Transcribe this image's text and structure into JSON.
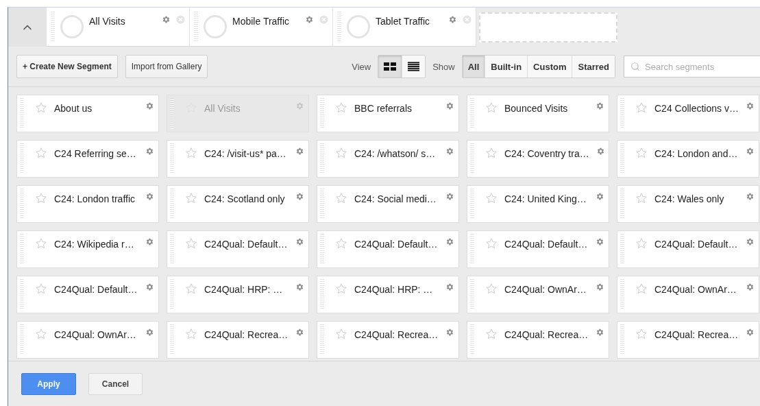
{
  "segment_bar": {
    "segments": [
      {
        "name": "All Visits"
      },
      {
        "name": "Mobile Traffic"
      },
      {
        "name": "Tablet Traffic"
      }
    ],
    "empty_slot": true
  },
  "toolbar": {
    "create_button": "+ Create New Segment",
    "import_button": "Import from Gallery",
    "view_label": "View",
    "view_modes": [
      {
        "kind": "grid",
        "selected": true
      },
      {
        "kind": "list",
        "selected": false
      }
    ],
    "show_label": "Show",
    "filters": [
      {
        "label": "All",
        "selected": true
      },
      {
        "label": "Built-in",
        "selected": false
      },
      {
        "label": "Custom",
        "selected": false
      },
      {
        "label": "Starred",
        "selected": false
      }
    ],
    "search": {
      "placeholder": "Search segments"
    }
  },
  "cards": [
    {
      "name": "About us",
      "starred": false,
      "disabled": false
    },
    {
      "name": "All Visits",
      "starred": false,
      "disabled": true
    },
    {
      "name": "BBC referrals",
      "starred": false,
      "disabled": false
    },
    {
      "name": "Bounced Visits",
      "starred": false,
      "disabled": false
    },
    {
      "name": "C24 Collections v…",
      "starred": false,
      "disabled": false
    },
    {
      "name": "C24 Referring se…",
      "starred": false,
      "disabled": false
    },
    {
      "name": "C24: /visit-us* pa…",
      "starred": false,
      "disabled": false
    },
    {
      "name": "C24: /whatson/ s…",
      "starred": false,
      "disabled": false
    },
    {
      "name": "C24: Coventry tra…",
      "starred": false,
      "disabled": false
    },
    {
      "name": "C24: London and…",
      "starred": false,
      "disabled": false
    },
    {
      "name": "C24: London traffic",
      "starred": false,
      "disabled": false
    },
    {
      "name": "C24: Scotland only",
      "starred": false,
      "disabled": false
    },
    {
      "name": "C24: Social medi…",
      "starred": false,
      "disabled": false
    },
    {
      "name": "C24: United King…",
      "starred": false,
      "disabled": false
    },
    {
      "name": "C24: Wales only",
      "starred": false,
      "disabled": false
    },
    {
      "name": "C24: Wikipedia r…",
      "starred": false,
      "disabled": false
    },
    {
      "name": "C24Qual: Default…",
      "starred": false,
      "disabled": false
    },
    {
      "name": "C24Qual: Default…",
      "starred": false,
      "disabled": false
    },
    {
      "name": "C24Qual: Default…",
      "starred": false,
      "disabled": false
    },
    {
      "name": "C24Qual: Default…",
      "starred": false,
      "disabled": false
    },
    {
      "name": "C24Qual: Default…",
      "starred": false,
      "disabled": false
    },
    {
      "name": "C24Qual: HRP: …",
      "starred": false,
      "disabled": false
    },
    {
      "name": "C24Qual: HRP: …",
      "starred": false,
      "disabled": false
    },
    {
      "name": "C24Qual: OwnAr…",
      "starred": false,
      "disabled": false
    },
    {
      "name": "C24Qual: OwnAr…",
      "starred": false,
      "disabled": false
    },
    {
      "name": "C24Qual: OwnAr…",
      "starred": false,
      "disabled": false
    },
    {
      "name": "C24Qual: Recrea…",
      "starred": false,
      "disabled": false
    },
    {
      "name": "C24Qual: Recrea…",
      "starred": false,
      "disabled": false
    },
    {
      "name": "C24Qual: Recrea…",
      "starred": false,
      "disabled": false
    },
    {
      "name": "C24Qual: Recrea…",
      "starred": false,
      "disabled": false
    }
  ],
  "footer": {
    "apply": "Apply",
    "cancel": "Cancel"
  }
}
